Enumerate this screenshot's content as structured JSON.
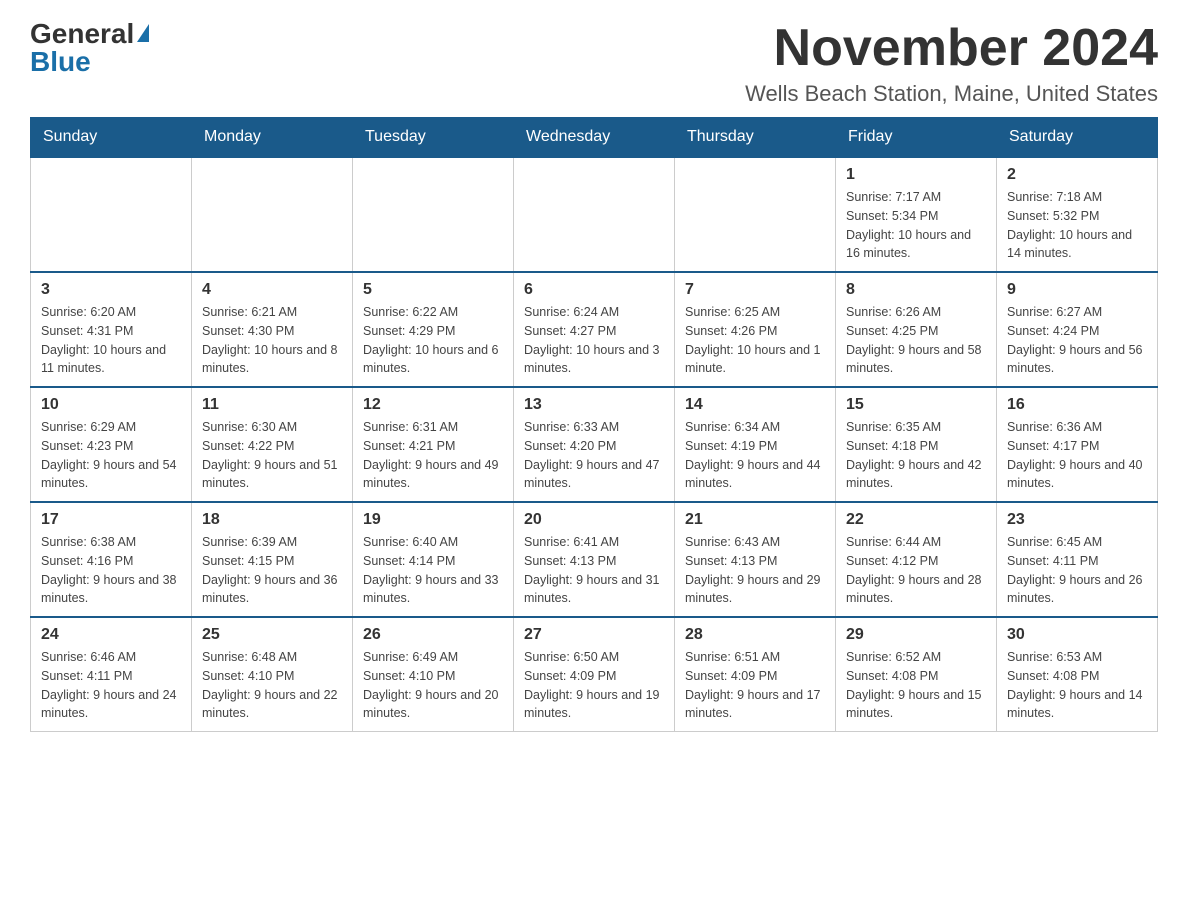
{
  "logo": {
    "general": "General",
    "triangle": "▶",
    "blue": "Blue"
  },
  "title": {
    "month_year": "November 2024",
    "location": "Wells Beach Station, Maine, United States"
  },
  "weekdays": [
    "Sunday",
    "Monday",
    "Tuesday",
    "Wednesday",
    "Thursday",
    "Friday",
    "Saturday"
  ],
  "weeks": [
    [
      {
        "day": "",
        "sunrise": "",
        "sunset": "",
        "daylight": ""
      },
      {
        "day": "",
        "sunrise": "",
        "sunset": "",
        "daylight": ""
      },
      {
        "day": "",
        "sunrise": "",
        "sunset": "",
        "daylight": ""
      },
      {
        "day": "",
        "sunrise": "",
        "sunset": "",
        "daylight": ""
      },
      {
        "day": "",
        "sunrise": "",
        "sunset": "",
        "daylight": ""
      },
      {
        "day": "1",
        "sunrise": "Sunrise: 7:17 AM",
        "sunset": "Sunset: 5:34 PM",
        "daylight": "Daylight: 10 hours and 16 minutes."
      },
      {
        "day": "2",
        "sunrise": "Sunrise: 7:18 AM",
        "sunset": "Sunset: 5:32 PM",
        "daylight": "Daylight: 10 hours and 14 minutes."
      }
    ],
    [
      {
        "day": "3",
        "sunrise": "Sunrise: 6:20 AM",
        "sunset": "Sunset: 4:31 PM",
        "daylight": "Daylight: 10 hours and 11 minutes."
      },
      {
        "day": "4",
        "sunrise": "Sunrise: 6:21 AM",
        "sunset": "Sunset: 4:30 PM",
        "daylight": "Daylight: 10 hours and 8 minutes."
      },
      {
        "day": "5",
        "sunrise": "Sunrise: 6:22 AM",
        "sunset": "Sunset: 4:29 PM",
        "daylight": "Daylight: 10 hours and 6 minutes."
      },
      {
        "day": "6",
        "sunrise": "Sunrise: 6:24 AM",
        "sunset": "Sunset: 4:27 PM",
        "daylight": "Daylight: 10 hours and 3 minutes."
      },
      {
        "day": "7",
        "sunrise": "Sunrise: 6:25 AM",
        "sunset": "Sunset: 4:26 PM",
        "daylight": "Daylight: 10 hours and 1 minute."
      },
      {
        "day": "8",
        "sunrise": "Sunrise: 6:26 AM",
        "sunset": "Sunset: 4:25 PM",
        "daylight": "Daylight: 9 hours and 58 minutes."
      },
      {
        "day": "9",
        "sunrise": "Sunrise: 6:27 AM",
        "sunset": "Sunset: 4:24 PM",
        "daylight": "Daylight: 9 hours and 56 minutes."
      }
    ],
    [
      {
        "day": "10",
        "sunrise": "Sunrise: 6:29 AM",
        "sunset": "Sunset: 4:23 PM",
        "daylight": "Daylight: 9 hours and 54 minutes."
      },
      {
        "day": "11",
        "sunrise": "Sunrise: 6:30 AM",
        "sunset": "Sunset: 4:22 PM",
        "daylight": "Daylight: 9 hours and 51 minutes."
      },
      {
        "day": "12",
        "sunrise": "Sunrise: 6:31 AM",
        "sunset": "Sunset: 4:21 PM",
        "daylight": "Daylight: 9 hours and 49 minutes."
      },
      {
        "day": "13",
        "sunrise": "Sunrise: 6:33 AM",
        "sunset": "Sunset: 4:20 PM",
        "daylight": "Daylight: 9 hours and 47 minutes."
      },
      {
        "day": "14",
        "sunrise": "Sunrise: 6:34 AM",
        "sunset": "Sunset: 4:19 PM",
        "daylight": "Daylight: 9 hours and 44 minutes."
      },
      {
        "day": "15",
        "sunrise": "Sunrise: 6:35 AM",
        "sunset": "Sunset: 4:18 PM",
        "daylight": "Daylight: 9 hours and 42 minutes."
      },
      {
        "day": "16",
        "sunrise": "Sunrise: 6:36 AM",
        "sunset": "Sunset: 4:17 PM",
        "daylight": "Daylight: 9 hours and 40 minutes."
      }
    ],
    [
      {
        "day": "17",
        "sunrise": "Sunrise: 6:38 AM",
        "sunset": "Sunset: 4:16 PM",
        "daylight": "Daylight: 9 hours and 38 minutes."
      },
      {
        "day": "18",
        "sunrise": "Sunrise: 6:39 AM",
        "sunset": "Sunset: 4:15 PM",
        "daylight": "Daylight: 9 hours and 36 minutes."
      },
      {
        "day": "19",
        "sunrise": "Sunrise: 6:40 AM",
        "sunset": "Sunset: 4:14 PM",
        "daylight": "Daylight: 9 hours and 33 minutes."
      },
      {
        "day": "20",
        "sunrise": "Sunrise: 6:41 AM",
        "sunset": "Sunset: 4:13 PM",
        "daylight": "Daylight: 9 hours and 31 minutes."
      },
      {
        "day": "21",
        "sunrise": "Sunrise: 6:43 AM",
        "sunset": "Sunset: 4:13 PM",
        "daylight": "Daylight: 9 hours and 29 minutes."
      },
      {
        "day": "22",
        "sunrise": "Sunrise: 6:44 AM",
        "sunset": "Sunset: 4:12 PM",
        "daylight": "Daylight: 9 hours and 28 minutes."
      },
      {
        "day": "23",
        "sunrise": "Sunrise: 6:45 AM",
        "sunset": "Sunset: 4:11 PM",
        "daylight": "Daylight: 9 hours and 26 minutes."
      }
    ],
    [
      {
        "day": "24",
        "sunrise": "Sunrise: 6:46 AM",
        "sunset": "Sunset: 4:11 PM",
        "daylight": "Daylight: 9 hours and 24 minutes."
      },
      {
        "day": "25",
        "sunrise": "Sunrise: 6:48 AM",
        "sunset": "Sunset: 4:10 PM",
        "daylight": "Daylight: 9 hours and 22 minutes."
      },
      {
        "day": "26",
        "sunrise": "Sunrise: 6:49 AM",
        "sunset": "Sunset: 4:10 PM",
        "daylight": "Daylight: 9 hours and 20 minutes."
      },
      {
        "day": "27",
        "sunrise": "Sunrise: 6:50 AM",
        "sunset": "Sunset: 4:09 PM",
        "daylight": "Daylight: 9 hours and 19 minutes."
      },
      {
        "day": "28",
        "sunrise": "Sunrise: 6:51 AM",
        "sunset": "Sunset: 4:09 PM",
        "daylight": "Daylight: 9 hours and 17 minutes."
      },
      {
        "day": "29",
        "sunrise": "Sunrise: 6:52 AM",
        "sunset": "Sunset: 4:08 PM",
        "daylight": "Daylight: 9 hours and 15 minutes."
      },
      {
        "day": "30",
        "sunrise": "Sunrise: 6:53 AM",
        "sunset": "Sunset: 4:08 PM",
        "daylight": "Daylight: 9 hours and 14 minutes."
      }
    ]
  ]
}
